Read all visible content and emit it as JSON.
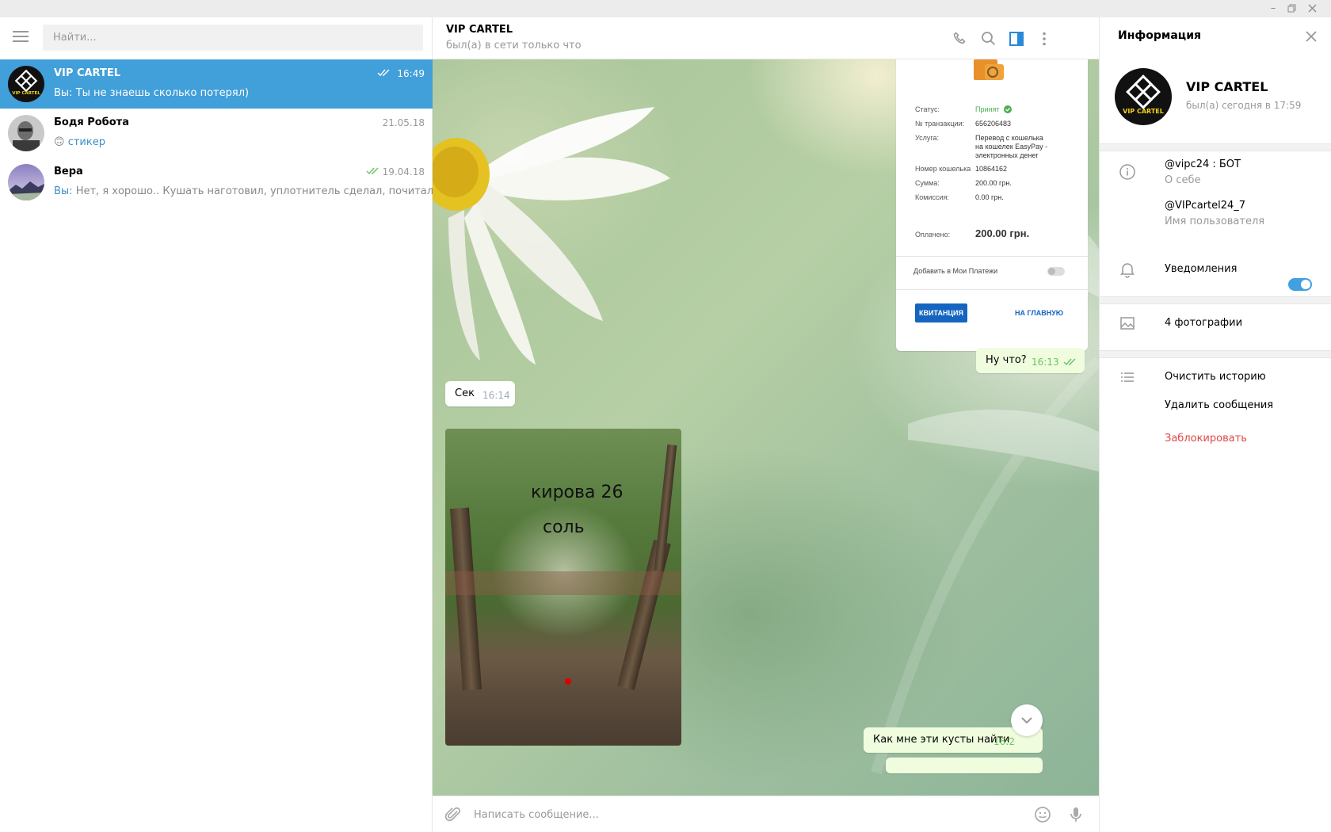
{
  "window": {
    "minimize_icon": "minimize-icon",
    "maximize_icon": "restore-icon",
    "close_icon": "close-icon"
  },
  "sidebar": {
    "search_placeholder": "Найти...",
    "dialogs": [
      {
        "name": "VIP CARTEL",
        "time": "16:49",
        "you_prefix": "Вы:",
        "preview": "Ты не знаешь сколько потерял)",
        "read": true,
        "active": true,
        "avatar": "vip-cartel-logo"
      },
      {
        "name": "Бодя Робота",
        "time": "21.05.18",
        "emoji": "🙃",
        "preview": "стикер",
        "read": false,
        "active": false,
        "avatar": "user-photo"
      },
      {
        "name": "Вера",
        "time": "19.04.18",
        "you_prefix": "Вы:",
        "preview": "Нет, я хорошо.. Кушать наготовил, уплотнитель сделал, почитал",
        "read": true,
        "active": false,
        "avatar": "landscape-photo"
      }
    ]
  },
  "chat": {
    "title": "VIP CARTEL",
    "status": "был(а) в сети только что",
    "receipt": {
      "status_label": "Статус:",
      "status_value": "Принят",
      "txn_label": "№ транзакции:",
      "txn_value": "656206483",
      "service_label": "Услуга:",
      "service_value_1": "Перевод с кошелька",
      "service_value_2": "на кошелек EasyPay -",
      "service_value_3": "электронных денег",
      "wallet_label": "Номер кошелька",
      "wallet_value": "10864162",
      "sum_label": "Сумма:",
      "sum_value": "200.00 грн.",
      "fee_label": "Комиссия:",
      "fee_value": "0.00 грн.",
      "paid_label": "Оплачено:",
      "paid_value": "200.00 грн.",
      "add_label": "Добавить в Мои Платежи",
      "receipt_button": "КВИТАНЦИЯ",
      "home_button": "НА ГЛАВНУЮ"
    },
    "messages": [
      {
        "text": "Ну что?",
        "time": "16:13",
        "out": true
      },
      {
        "text": "Сек",
        "time": "16:14",
        "out": false
      },
      {
        "text": "Как мне эти кусты найти",
        "time": "16:2",
        "out": true
      }
    ],
    "photo_caption_1": "кирова 26",
    "photo_caption_2": "соль",
    "composer_placeholder": "Написать сообщение..."
  },
  "info_panel": {
    "title": "Информация",
    "name": "VIP CARTEL",
    "status": "был(а) сегодня в 17:59",
    "bio": "@vipc24 : БОТ",
    "bio_label": "О себе",
    "username": "@VIPcartel24_7",
    "username_label": "Имя пользователя",
    "notifications_label": "Уведомления",
    "notifications_on": true,
    "photos_label": "4 фотографии",
    "clear_history": "Очистить историю",
    "delete_messages": "Удалить сообщения",
    "block": "Заблокировать"
  },
  "colors": {
    "accent": "#419fd9",
    "read_check": "#6cc264",
    "danger": "#e04848",
    "out_bubble": "#effdde"
  }
}
